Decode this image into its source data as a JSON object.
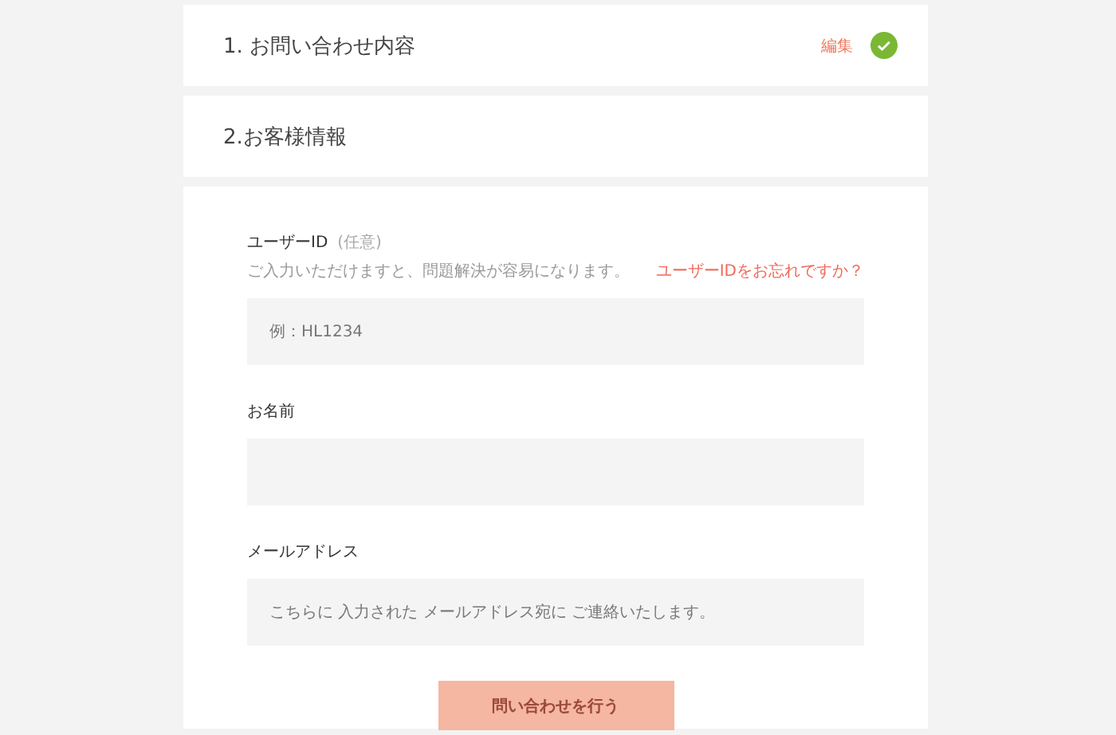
{
  "steps": [
    {
      "title": "1. お問い合わせ内容",
      "edit": "編集",
      "completed": true
    },
    {
      "title": "2.お客様情報",
      "completed": false
    }
  ],
  "fields": [
    {
      "label": "ユーザーID",
      "optional": "(任意)",
      "hint": "ご入力いただけますと、問題解決が容易になります。",
      "link": "ユーザーIDをお忘れですか？",
      "placeholder": "例：HL1234"
    },
    {
      "label": "お名前"
    },
    {
      "label": "メールアドレス",
      "placeholder": "こちらに 入力された メールアドレス宛に ご連絡いたします。"
    }
  ],
  "submit": {
    "label": "問い合わせを行う",
    "disabled": true
  }
}
